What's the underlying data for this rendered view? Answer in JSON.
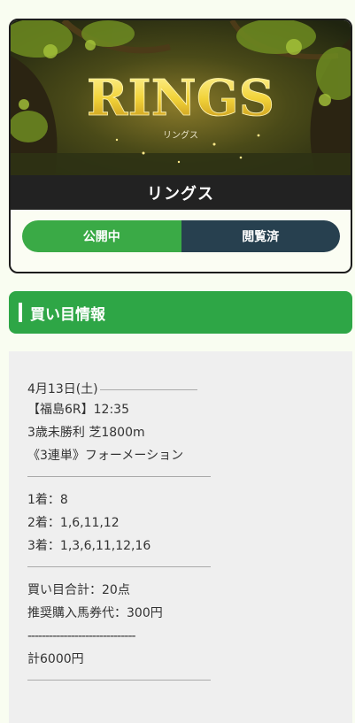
{
  "card": {
    "banner_logo": "RINGS",
    "banner_sub": "リングス",
    "title": "リングス",
    "status_public": "公開中",
    "status_viewed": "閲覧済"
  },
  "section": {
    "title": "買い目情報"
  },
  "info": {
    "date": "4月13日(土)",
    "race": "【福島6R】12:35",
    "condition": "3歳未勝利 芝1800m",
    "bet_type": "《3連単》フォーメーション",
    "first": "1着：8",
    "second": "2着：1,6,11,12",
    "third": "3着：1,3,6,11,12,16",
    "total_points": "買い目合計：20点",
    "recommended": "推奨購入馬券代：300円",
    "dashes": "------------------------------",
    "total_amount": "計6000円"
  },
  "colors": {
    "green": "#2ea646",
    "navy": "#27404f",
    "page_bg": "#f9fdf1",
    "content_bg": "#efefef"
  }
}
